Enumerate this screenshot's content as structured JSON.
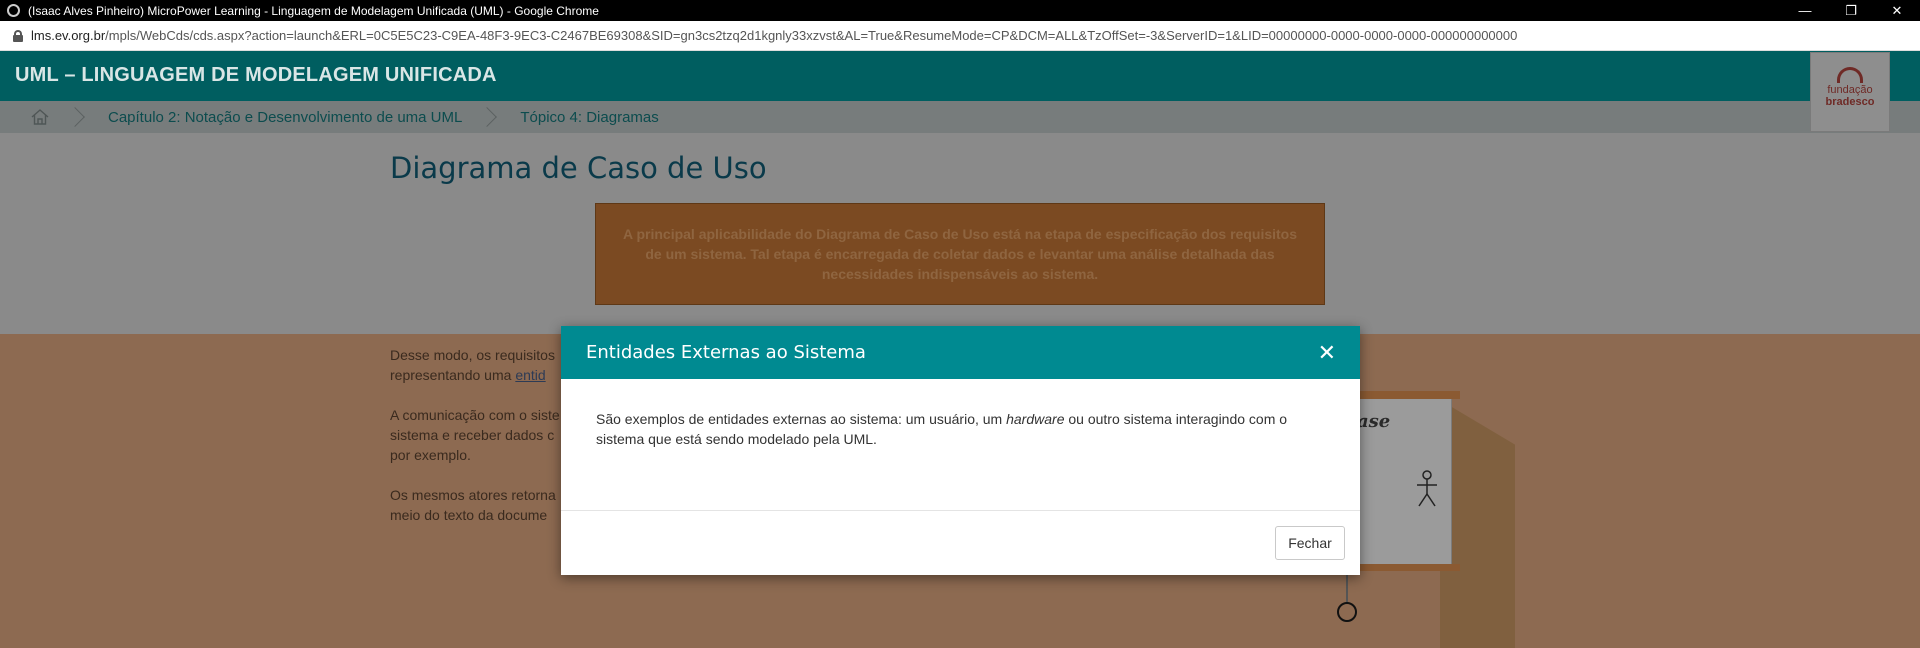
{
  "browser": {
    "window_title": "(Isaac Alves Pinheiro) MicroPower Learning - Linguagem de Modelagem Unificada (UML) - Google Chrome",
    "url_domain": "lms.ev.org.br",
    "url_path": "/mpls/WebCds/cds.aspx?action=launch&ERL=0C5E5C23-C9EA-48F3-9EC3-C2467BE69308&SID=gn3cs2tzq2d1kgnly33xzvst&AL=True&ResumeMode=CP&DCM=ALL&TzOffSet=-3&ServerID=1&LID=00000000-0000-0000-0000-000000000000",
    "minimize": "—",
    "restore": "❐",
    "close": "✕"
  },
  "header": {
    "course_title": "UML – LINGUAGEM DE MODELAGEM UNIFICADA",
    "logo_line1": "fundação",
    "logo_line2": "bradesco"
  },
  "breadcrumb": {
    "chapter": "Capítulo 2: Notação e Desenvolvimento de uma UML",
    "topic": "Tópico 4: Diagramas"
  },
  "page": {
    "heading": "Diagrama de Caso de Uso",
    "highlight": "A principal aplicabilidade do Diagrama de Caso de Uso está na etapa de especificação dos requisitos de um sistema. Tal etapa é encarregada de coletar dados e levantar uma análise detalhada das necessidades indispensáveis ao sistema.",
    "para1_line1": "Desse modo, os requisitos",
    "para1_line2_prefix": "representando uma ",
    "para1_link": "entid",
    "para2_line1": "A comunicação com o siste",
    "para2_line2": "sistema e receber dados c",
    "para2_line3": "por exemplo.",
    "para3_line1": "Os mesmos atores retorna",
    "para3_line2": "meio do texto da docume",
    "illustration_text": "ase"
  },
  "modal": {
    "title": "Entidades Externas ao Sistema",
    "close_icon": "✕",
    "body_prefix": "São exemplos de entidades externas ao sistema: um usuário, um ",
    "body_emphasis": "hardware",
    "body_suffix": " ou outro sistema interagindo com o sistema que está sendo modelado pela UML.",
    "close_button": "Fechar"
  }
}
